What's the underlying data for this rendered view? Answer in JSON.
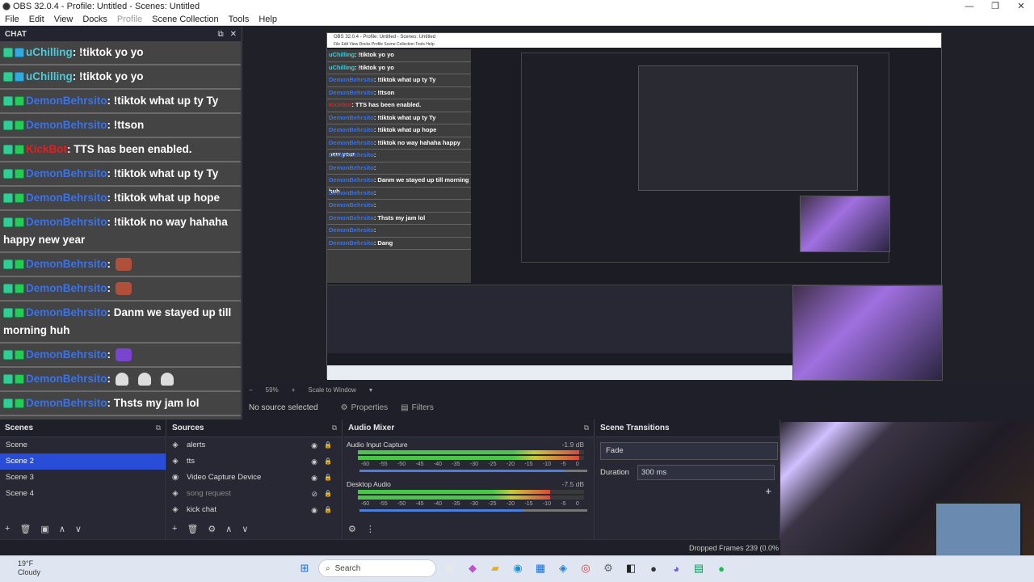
{
  "window": {
    "title": "OBS 32.0.4 - Profile: Untitled - Scenes: Untitled",
    "min": "—",
    "max": "❐",
    "close": "✕"
  },
  "menu": [
    "File",
    "Edit",
    "View",
    "Docks",
    "Profile",
    "Scene Collection",
    "Tools",
    "Help"
  ],
  "chat": {
    "header": "CHAT",
    "messages": [
      {
        "user": "uChilling",
        "color": "#4ec9d8",
        "text": ": !tiktok yo yo",
        "badges": [
          "mod",
          "blue"
        ]
      },
      {
        "user": "uChilling",
        "color": "#4ec9d8",
        "text": ": !tiktok yo yo",
        "badges": [
          "mod",
          "blue"
        ]
      },
      {
        "user": "DemonBehrsito",
        "color": "#3a72e8",
        "text": ": !tiktok what up ty Ty",
        "badges": [
          "mod",
          "grn"
        ]
      },
      {
        "user": "DemonBehrsito",
        "color": "#3a72e8",
        "text": ": !ttson",
        "badges": [
          "mod",
          "grn"
        ]
      },
      {
        "user": "KickBot",
        "color": "#e02020",
        "text": ": TTS has been enabled.",
        "badges": [
          "mod",
          "grn"
        ]
      },
      {
        "user": "DemonBehrsito",
        "color": "#3a72e8",
        "text": ": !tiktok what up ty Ty",
        "badges": [
          "mod",
          "grn"
        ]
      },
      {
        "user": "DemonBehrsito",
        "color": "#3a72e8",
        "text": ": !tiktok what up hope",
        "badges": [
          "mod",
          "grn"
        ]
      },
      {
        "user": "DemonBehrsito",
        "color": "#3a72e8",
        "text": ": !tiktok no way hahaha happy new year",
        "badges": [
          "mod",
          "grn"
        ]
      },
      {
        "user": "DemonBehrsito",
        "color": "#3a72e8",
        "text": ":",
        "badges": [
          "mod",
          "grn"
        ],
        "emote": "face"
      },
      {
        "user": "DemonBehrsito",
        "color": "#3a72e8",
        "text": ":",
        "badges": [
          "mod",
          "grn"
        ],
        "emote": "face"
      },
      {
        "user": "DemonBehrsito",
        "color": "#3a72e8",
        "text": ": Danm we stayed up till morning huh",
        "badges": [
          "mod",
          "grn"
        ]
      },
      {
        "user": "DemonBehrsito",
        "color": "#3a72e8",
        "text": ":",
        "badges": [
          "mod",
          "grn"
        ],
        "emote": "purple"
      },
      {
        "user": "DemonBehrsito",
        "color": "#3a72e8",
        "text": ":",
        "badges": [
          "mod",
          "grn"
        ],
        "emote": "ghost"
      },
      {
        "user": "DemonBehrsito",
        "color": "#3a72e8",
        "text": ": Thsts my jam lol",
        "badges": [
          "mod",
          "grn"
        ]
      },
      {
        "user": "DemonBehrsito",
        "color": "#3a72e8",
        "text": ":",
        "badges": [
          "mod",
          "grn"
        ],
        "emote": "face"
      },
      {
        "user": "DemonBehrsito",
        "color": "#3a72e8",
        "text": ": Dang",
        "badges": [
          "mod",
          "grn"
        ],
        "emote": "face"
      }
    ]
  },
  "preview_footer": {
    "zoom": "59%",
    "scale": "Scale to Window"
  },
  "source_bar": {
    "no_source": "No source selected",
    "properties": "Properties",
    "filters": "Filters"
  },
  "scenes": {
    "title": "Scenes",
    "items": [
      "Scene",
      "Scene 2",
      "Scene 3",
      "Scene 4"
    ],
    "selected": 1
  },
  "sources": {
    "title": "Sources",
    "items": [
      {
        "name": "alerts",
        "icon": "◈",
        "dim": false
      },
      {
        "name": "tts",
        "icon": "◈",
        "dim": false
      },
      {
        "name": "Video Capture Device",
        "icon": "◉",
        "dim": false
      },
      {
        "name": "song request",
        "icon": "◈",
        "dim": true
      },
      {
        "name": "kick chat",
        "icon": "◈",
        "dim": false
      }
    ]
  },
  "mixer": {
    "title": "Audio Mixer",
    "channels": [
      {
        "name": "Audio Input Capture",
        "db": "-1.9 dB",
        "level": 0.98,
        "volume": 0.9
      },
      {
        "name": "Desktop Audio",
        "db": "-7.5 dB",
        "level": 0.85,
        "volume": 0.72
      }
    ],
    "scale": [
      "-60",
      "-55",
      "-50",
      "-45",
      "-40",
      "-35",
      "-30",
      "-25",
      "-20",
      "-15",
      "-10",
      "-5",
      "0"
    ]
  },
  "transitions": {
    "title": "Scene Transitions",
    "type": "Fade",
    "duration_label": "Duration",
    "duration": "300 ms"
  },
  "status": {
    "dropped": "Dropped Frames 239 (0.0%"
  },
  "taskbar": {
    "temp": "19°F",
    "weather": "Cloudy",
    "search": "Search"
  }
}
